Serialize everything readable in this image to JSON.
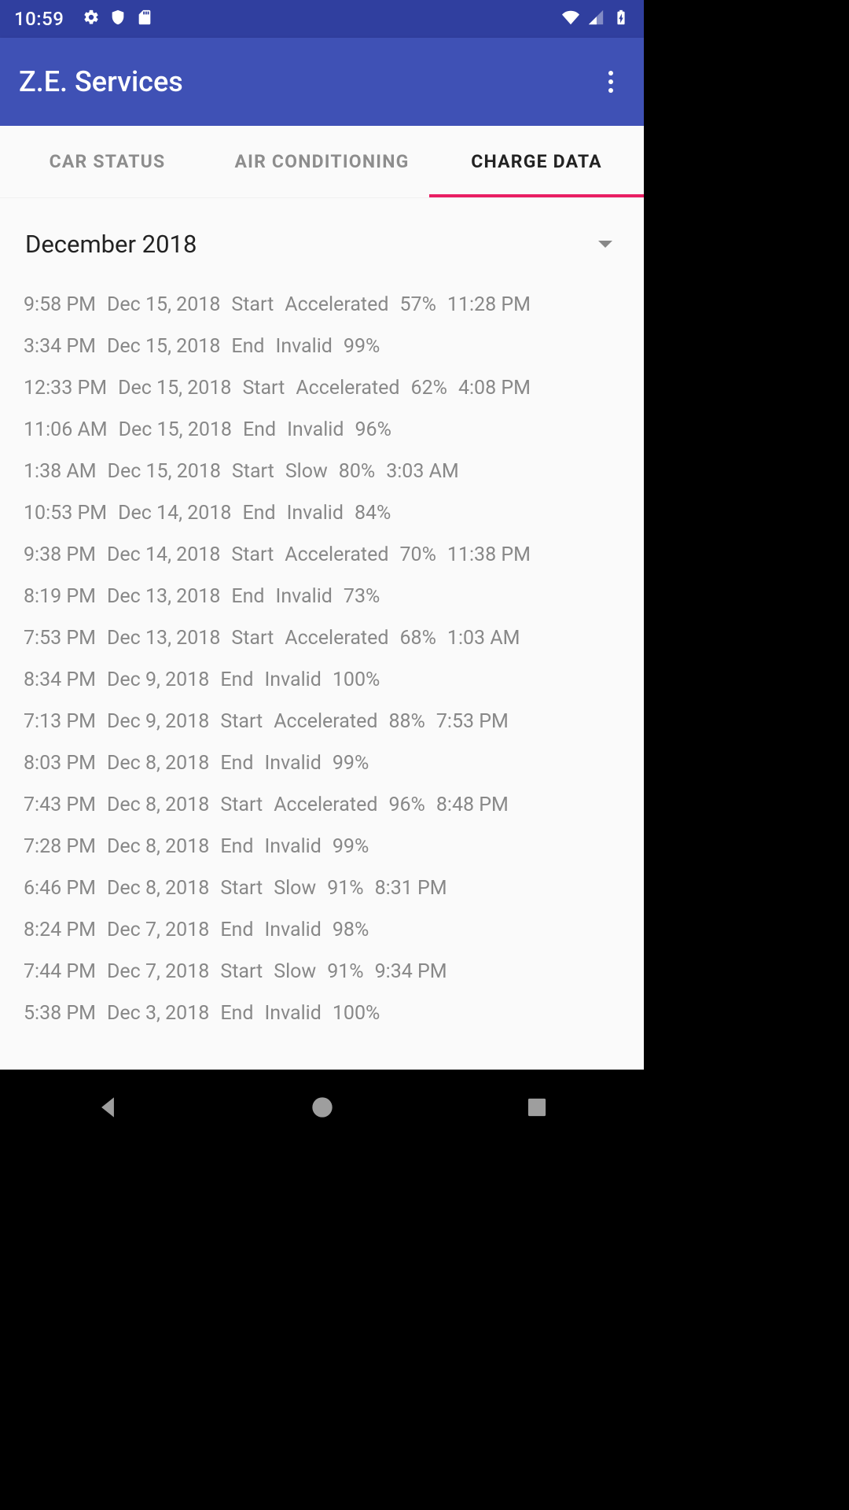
{
  "statusbar": {
    "time": "10:59"
  },
  "appbar": {
    "title": "Z.E. Services"
  },
  "tabs": {
    "items": [
      {
        "label": "CAR STATUS"
      },
      {
        "label": "AIR CONDITIONING"
      },
      {
        "label": "CHARGE DATA"
      }
    ],
    "active_index": 2
  },
  "content": {
    "month_header": "December 2018",
    "rows": [
      {
        "time": "9:58 PM",
        "date": "Dec 15, 2018",
        "kind": "Start",
        "mode": "Accelerated",
        "pct": "57%",
        "end_time": "11:28 PM"
      },
      {
        "time": "3:34 PM",
        "date": "Dec 15, 2018",
        "kind": "End",
        "mode": "Invalid",
        "pct": "99%",
        "end_time": ""
      },
      {
        "time": "12:33 PM",
        "date": "Dec 15, 2018",
        "kind": "Start",
        "mode": "Accelerated",
        "pct": "62%",
        "end_time": "4:08 PM"
      },
      {
        "time": "11:06 AM",
        "date": "Dec 15, 2018",
        "kind": "End",
        "mode": "Invalid",
        "pct": "96%",
        "end_time": ""
      },
      {
        "time": "1:38 AM",
        "date": "Dec 15, 2018",
        "kind": "Start",
        "mode": "Slow",
        "pct": "80%",
        "end_time": "3:03 AM"
      },
      {
        "time": "10:53 PM",
        "date": "Dec 14, 2018",
        "kind": "End",
        "mode": "Invalid",
        "pct": "84%",
        "end_time": ""
      },
      {
        "time": "9:38 PM",
        "date": "Dec 14, 2018",
        "kind": "Start",
        "mode": "Accelerated",
        "pct": "70%",
        "end_time": "11:38 PM"
      },
      {
        "time": "8:19 PM",
        "date": "Dec 13, 2018",
        "kind": "End",
        "mode": "Invalid",
        "pct": "73%",
        "end_time": ""
      },
      {
        "time": "7:53 PM",
        "date": "Dec 13, 2018",
        "kind": "Start",
        "mode": "Accelerated",
        "pct": "68%",
        "end_time": "1:03 AM"
      },
      {
        "time": "8:34 PM",
        "date": "Dec 9, 2018",
        "kind": "End",
        "mode": "Invalid",
        "pct": "100%",
        "end_time": ""
      },
      {
        "time": "7:13 PM",
        "date": "Dec 9, 2018",
        "kind": "Start",
        "mode": "Accelerated",
        "pct": "88%",
        "end_time": "7:53 PM"
      },
      {
        "time": "8:03 PM",
        "date": "Dec 8, 2018",
        "kind": "End",
        "mode": "Invalid",
        "pct": "99%",
        "end_time": ""
      },
      {
        "time": "7:43 PM",
        "date": "Dec 8, 2018",
        "kind": "Start",
        "mode": "Accelerated",
        "pct": "96%",
        "end_time": "8:48 PM"
      },
      {
        "time": "7:28 PM",
        "date": "Dec 8, 2018",
        "kind": "End",
        "mode": "Invalid",
        "pct": "99%",
        "end_time": ""
      },
      {
        "time": "6:46 PM",
        "date": "Dec 8, 2018",
        "kind": "Start",
        "mode": "Slow",
        "pct": "91%",
        "end_time": "8:31 PM"
      },
      {
        "time": "8:24 PM",
        "date": "Dec 7, 2018",
        "kind": "End",
        "mode": "Invalid",
        "pct": "98%",
        "end_time": ""
      },
      {
        "time": "7:44 PM",
        "date": "Dec 7, 2018",
        "kind": "Start",
        "mode": "Slow",
        "pct": "91%",
        "end_time": "9:34 PM"
      },
      {
        "time": "5:38 PM",
        "date": "Dec 3, 2018",
        "kind": "End",
        "mode": "Invalid",
        "pct": "100%",
        "end_time": ""
      }
    ]
  }
}
